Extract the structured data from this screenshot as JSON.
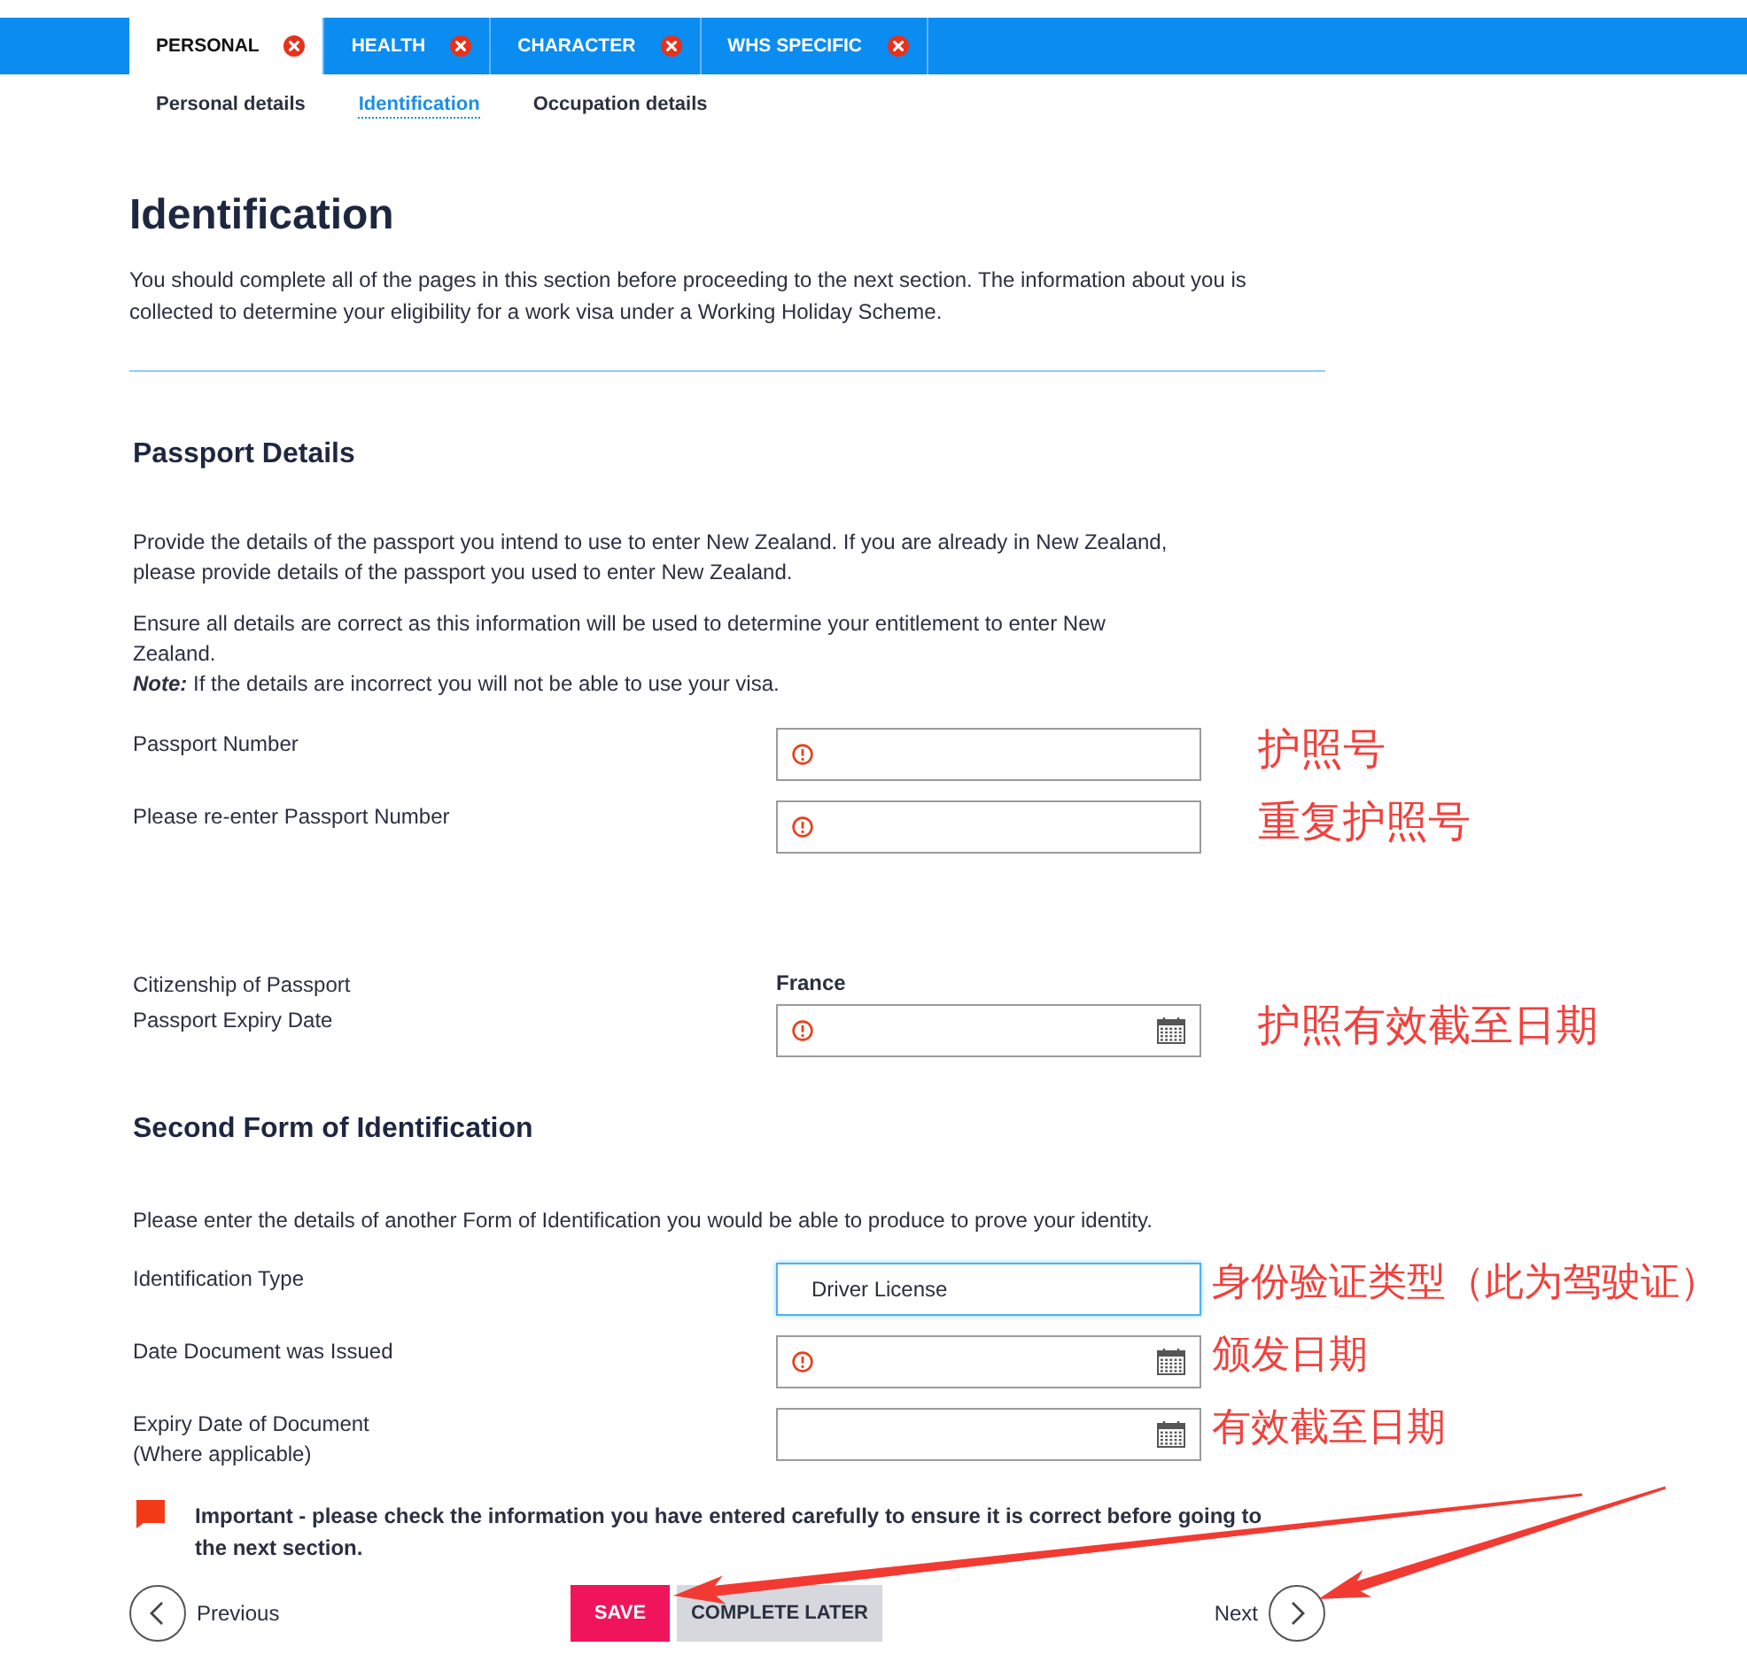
{
  "tabs": [
    {
      "label": "PERSONAL",
      "selected": true,
      "incomplete": true
    },
    {
      "label": "HEALTH",
      "selected": false,
      "incomplete": true
    },
    {
      "label": "CHARACTER",
      "selected": false,
      "incomplete": true
    },
    {
      "label": "WHS SPECIFIC",
      "selected": false,
      "incomplete": true
    }
  ],
  "subtabs": [
    {
      "label": "Personal details",
      "selected": false
    },
    {
      "label": "Identification",
      "selected": true
    },
    {
      "label": "Occupation details",
      "selected": false
    }
  ],
  "page": {
    "title": "Identification",
    "intro": "You should complete all of the pages in this section before proceeding to the next section. The information about you is collected to determine your eligibility for a work visa under a Working Holiday Scheme."
  },
  "sections": [
    {
      "title": "Passport Details",
      "paragraphs": [
        {
          "text": "Provide the details of the passport you intend to use to enter New Zealand. If you are already in New Zealand, please provide details of the passport you used to enter New Zealand."
        },
        {
          "text": "Ensure all details are correct as this information will be used to determine your entitlement to enter New Zealand.",
          "note": "**Note:** If the details are incorrect you will not be able to use your visa."
        }
      ],
      "fields": [
        {
          "kind": "text",
          "label": "Passport Number",
          "error": true,
          "focused": false,
          "annotation": "护照号"
        },
        {
          "kind": "text",
          "label": "Please re-enter Passport Number",
          "error": true,
          "focused": false,
          "annotation": "重复护照号"
        },
        {
          "kind": "static",
          "label": "Citizenship of Passport",
          "value": "France"
        },
        {
          "kind": "date",
          "label": "Passport Expiry Date",
          "error": true,
          "focused": false,
          "annotation": "护照有效截至日期"
        }
      ]
    },
    {
      "title": "Second Form of Identification",
      "paragraphs": [
        {
          "text": "Please enter the details of another Form of Identification you would be able to produce to prove your identity."
        }
      ],
      "fields": [
        {
          "kind": "select",
          "label": "Identification Type",
          "value": "Driver License",
          "error": false,
          "focused": true,
          "annotation": "身份验证类型（此为驾驶证）"
        },
        {
          "kind": "date",
          "label": "Date Document was Issued",
          "error": true,
          "focused": false,
          "annotation": "颁发日期"
        },
        {
          "kind": "date",
          "label": "Expiry Date of Document",
          "label_note": "(Where applicable)",
          "error": false,
          "focused": false,
          "annotation": "有效截至日期"
        }
      ]
    }
  ],
  "notice": {
    "text": "Important - please check the information you have entered carefully to ensure it is correct before going to the next section."
  },
  "footer": {
    "previous": "Previous",
    "save": "SAVE",
    "complete_later": "COMPLETE LATER",
    "next": "Next"
  }
}
